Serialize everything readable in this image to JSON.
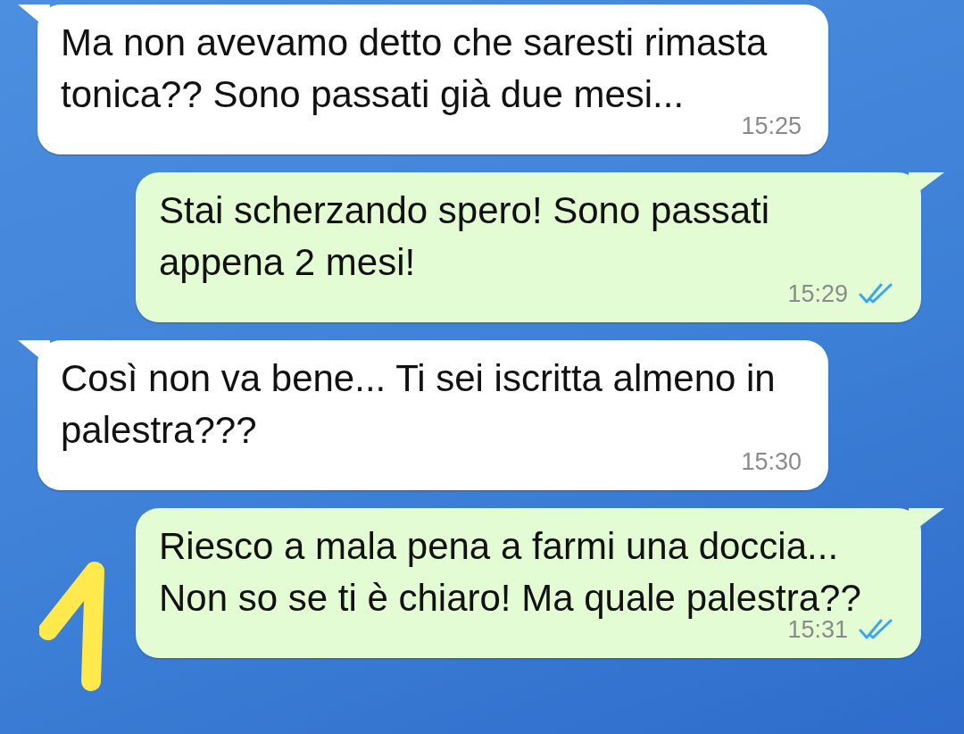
{
  "messages": [
    {
      "kind": "incoming",
      "text": "Ma non avevamo detto che saresti rimasta tonica?? Sono passati già due mesi...",
      "time": "15:25"
    },
    {
      "kind": "outgoing",
      "text": "Stai scherzando spero! Sono passati appena 2 mesi!",
      "time": "15:29",
      "read": true
    },
    {
      "kind": "incoming",
      "text": "Così non va bene... Ti sei iscritta almeno in palestra???",
      "time": "15:30"
    },
    {
      "kind": "outgoing",
      "text": "Riesco a mala pena a farmi una doccia... Non so se ti è chiaro! Ma quale palestra??",
      "time": "15:31",
      "read": true
    }
  ]
}
